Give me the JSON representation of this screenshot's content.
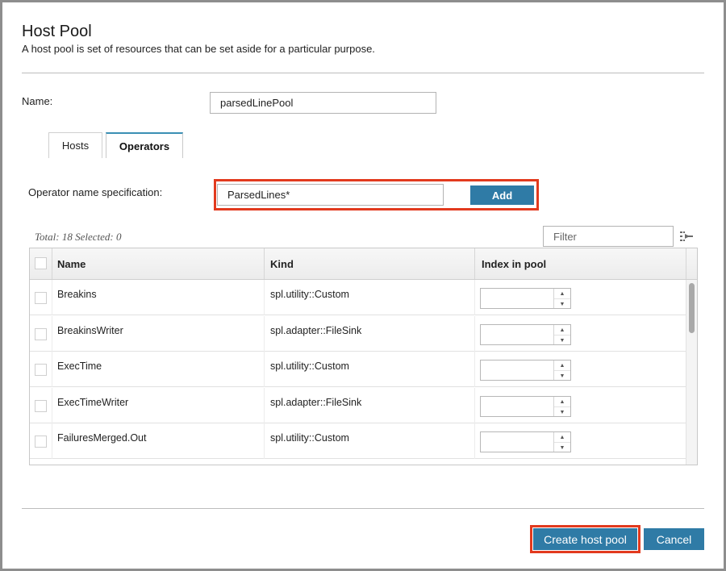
{
  "dialog": {
    "title": "Host Pool",
    "subtitle": "A host pool is set of resources that can be set aside for a particular purpose."
  },
  "name_field": {
    "label": "Name:",
    "value": "parsedLinePool"
  },
  "tabs": [
    {
      "label": "Hosts",
      "active": false
    },
    {
      "label": "Operators",
      "active": true
    }
  ],
  "operator_spec": {
    "label": "Operator name specification:",
    "value": "ParsedLines*",
    "add_label": "Add"
  },
  "table": {
    "summary": "Total: 18 Selected: 0",
    "filter_placeholder": "Filter",
    "columns": [
      "Name",
      "Kind",
      "Index in pool"
    ],
    "rows": [
      {
        "name": "Breakins",
        "kind": "spl.utility::Custom",
        "index": ""
      },
      {
        "name": "BreakinsWriter",
        "kind": "spl.adapter::FileSink",
        "index": ""
      },
      {
        "name": "ExecTime",
        "kind": "spl.utility::Custom",
        "index": ""
      },
      {
        "name": "ExecTimeWriter",
        "kind": "spl.adapter::FileSink",
        "index": ""
      },
      {
        "name": "FailuresMerged.Out",
        "kind": "spl.utility::Custom",
        "index": ""
      }
    ]
  },
  "footer": {
    "create_label": "Create host pool",
    "cancel_label": "Cancel"
  },
  "colors": {
    "accent": "#2f7ba6",
    "highlight": "#e23a1e",
    "tab_active": "#3b8fb4"
  },
  "icons": {
    "filter_options": "filter-options-icon",
    "spinner_up": "triangle-up",
    "spinner_down": "triangle-down"
  }
}
